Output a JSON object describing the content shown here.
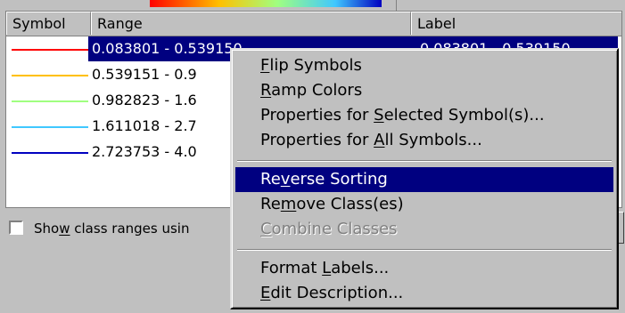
{
  "table": {
    "headers": {
      "symbol": "Symbol",
      "range": "Range",
      "label": "Label"
    },
    "rows": [
      {
        "color": "#ff0000",
        "range": "0.083801 - 0.539150",
        "label": "0.083801 - 0.539150",
        "selected": true
      },
      {
        "color": "#ffc000",
        "range": "0.539151 - 0.9",
        "label": ""
      },
      {
        "color": "#a0ff80",
        "range": "0.982823 - 1.6",
        "label": ""
      },
      {
        "color": "#40c8ff",
        "range": "1.611018 - 2.7",
        "label": ""
      },
      {
        "color": "#0000c0",
        "range": "2.723753 - 4.0",
        "label": ""
      }
    ]
  },
  "checkbox": {
    "label_pre": "Sho",
    "label_u": "w",
    "label_post": " class ranges usin",
    "checked": false
  },
  "menu": {
    "items": [
      {
        "pre": "",
        "u": "F",
        "post": "lip Symbols",
        "state": "normal"
      },
      {
        "pre": "",
        "u": "R",
        "post": "amp Colors",
        "state": "normal"
      },
      {
        "pre": "Properties for ",
        "u": "S",
        "post": "elected Symbol(s)...",
        "state": "normal"
      },
      {
        "pre": "Properties for ",
        "u": "A",
        "post": "ll Symbols...",
        "state": "normal"
      },
      {
        "pre": "Re",
        "u": "v",
        "post": "erse Sorting",
        "state": "highlighted"
      },
      {
        "pre": "Re",
        "u": "m",
        "post": "ove Class(es)",
        "state": "normal"
      },
      {
        "pre": "",
        "u": "C",
        "post": "ombine Classes",
        "state": "disabled"
      },
      {
        "pre": "Format ",
        "u": "L",
        "post": "abels...",
        "state": "normal"
      },
      {
        "pre": "",
        "u": "E",
        "post": "dit Description...",
        "state": "normal"
      }
    ]
  }
}
